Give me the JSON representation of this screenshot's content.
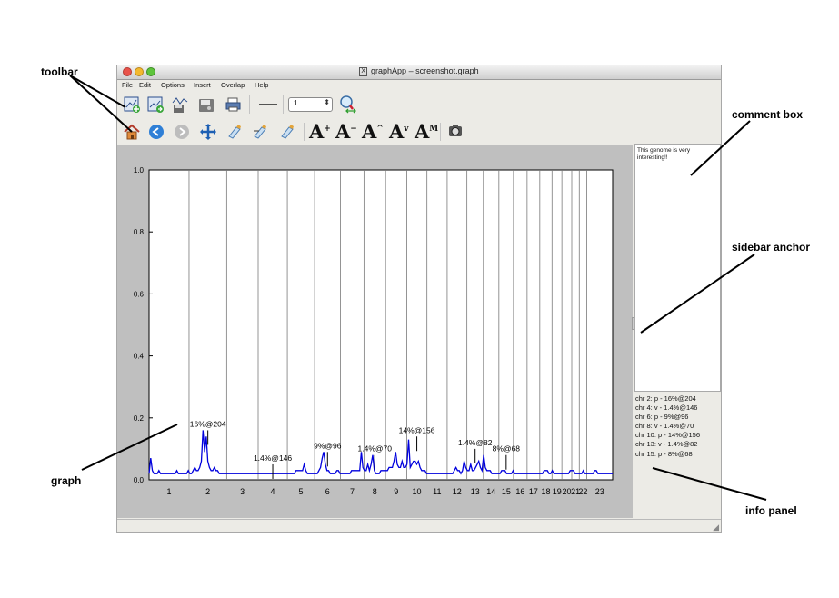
{
  "callouts": {
    "toolbar": "toolbar",
    "comment_box": "comment box",
    "sidebar_anchor": "sidebar anchor",
    "graph": "graph",
    "info_panel": "info panel"
  },
  "window": {
    "title": "graphApp – screenshot.graph",
    "title_icon": "X",
    "menu": [
      "File",
      "Edit",
      "Options",
      "Insert",
      "Overlap",
      "Help"
    ]
  },
  "toolbar": {
    "row1_icons": [
      "new-graph-icon",
      "open-graph-icon",
      "save-graph-icon",
      "save-as-icon",
      "print-icon",
      "line-style-icon",
      "zoom-icon"
    ],
    "line_width_value": "1",
    "row2_icons": [
      "home-icon",
      "back-icon",
      "forward-icon",
      "pan-icon",
      "zoom-in-icon",
      "zoom-out-icon",
      "zoom-reset-icon",
      "font-bigger-icon",
      "font-smaller-icon",
      "font-up-icon",
      "font-down-icon",
      "font-max-icon",
      "screenshot-icon"
    ]
  },
  "comment": {
    "text": "This genome is very interesting!!"
  },
  "info": {
    "lines": [
      "chr 2: p - 16%@204",
      "chr 4: v - 1.4%@146",
      "chr 6: p - 9%@96",
      "chr 8: v - 1.4%@70",
      "chr 10: p - 14%@156",
      "chr 13: v - 1.4%@82",
      "chr 15: p - 8%@68"
    ]
  },
  "chart_data": {
    "type": "line",
    "title": "",
    "xlabel": "",
    "ylabel": "",
    "ylim": [
      0,
      1.0
    ],
    "yticks": [
      "0.0",
      "0.2",
      "0.4",
      "0.6",
      "0.8",
      "1.0"
    ],
    "chromosomes": [
      "1",
      "2",
      "3",
      "4",
      "5",
      "6",
      "7",
      "8",
      "9",
      "10",
      "11",
      "12",
      "13",
      "14",
      "15",
      "16",
      "17",
      "18",
      "19",
      "20",
      "21",
      "22",
      "23"
    ],
    "line_color": "#0000dd",
    "series": [
      {
        "values": [
          0.02,
          0.07,
          0.03,
          0.02,
          0.02,
          0.02,
          0.03,
          0.02,
          0.02,
          0.02,
          0.02,
          0.02,
          0.02,
          0.02,
          0.02,
          0.02,
          0.02,
          0.03,
          0.02,
          0.02,
          0.02,
          0.02,
          0.02,
          0.02,
          0.03,
          0.02,
          0.02,
          0.03,
          0.04,
          0.03,
          0.03,
          0.04,
          0.06,
          0.16,
          0.09,
          0.14,
          0.06,
          0.04,
          0.03,
          0.03,
          0.04,
          0.03,
          0.03,
          0.02,
          0.02,
          0.02,
          0.02,
          0.02,
          0.02,
          0.02,
          0.02,
          0.02,
          0.02,
          0.02,
          0.02,
          0.02,
          0.02,
          0.02,
          0.02,
          0.02,
          0.02,
          0.02,
          0.02,
          0.02,
          0.02,
          0.02,
          0.02,
          0.02,
          0.02,
          0.02,
          0.02,
          0.02,
          0.02,
          0.02,
          0.02,
          0.02,
          0.02,
          0.02,
          0.02,
          0.02,
          0.02,
          0.02,
          0.02,
          0.02,
          0.02,
          0.02,
          0.02,
          0.02,
          0.02,
          0.02,
          0.03,
          0.03,
          0.03,
          0.03,
          0.03,
          0.05,
          0.03,
          0.02,
          0.02,
          0.02,
          0.02,
          0.02,
          0.02,
          0.02,
          0.03,
          0.04,
          0.07,
          0.09,
          0.05,
          0.03,
          0.03,
          0.02,
          0.02,
          0.02,
          0.02,
          0.03,
          0.03,
          0.02,
          0.02,
          0.02,
          0.02,
          0.02,
          0.02,
          0.02,
          0.03,
          0.03,
          0.03,
          0.03,
          0.03,
          0.03,
          0.09,
          0.04,
          0.03,
          0.03,
          0.05,
          0.03,
          0.05,
          0.08,
          0.03,
          0.02,
          0.02,
          0.02,
          0.03,
          0.03,
          0.03,
          0.03,
          0.03,
          0.04,
          0.04,
          0.04,
          0.06,
          0.09,
          0.05,
          0.04,
          0.04,
          0.06,
          0.04,
          0.04,
          0.05,
          0.13,
          0.04,
          0.05,
          0.06,
          0.06,
          0.05,
          0.06,
          0.04,
          0.03,
          0.03,
          0.03,
          0.02,
          0.02,
          0.02,
          0.02,
          0.02,
          0.02,
          0.02,
          0.02,
          0.02,
          0.02,
          0.02,
          0.02,
          0.02,
          0.02,
          0.02,
          0.02,
          0.02,
          0.03,
          0.04,
          0.03,
          0.03,
          0.02,
          0.03,
          0.06,
          0.04,
          0.03,
          0.03,
          0.05,
          0.03,
          0.03,
          0.04,
          0.05,
          0.06,
          0.04,
          0.03,
          0.08,
          0.04,
          0.03,
          0.03,
          0.03,
          0.02,
          0.02,
          0.02,
          0.02,
          0.02,
          0.02,
          0.03,
          0.03,
          0.03,
          0.02,
          0.02,
          0.02,
          0.02,
          0.03,
          0.02,
          0.02,
          0.02,
          0.02,
          0.02,
          0.02,
          0.02,
          0.02,
          0.02,
          0.02,
          0.02,
          0.02,
          0.02,
          0.02,
          0.02,
          0.02,
          0.02,
          0.02,
          0.03,
          0.03,
          0.03,
          0.02,
          0.02,
          0.03,
          0.02,
          0.02,
          0.02,
          0.02,
          0.02,
          0.02,
          0.02,
          0.02,
          0.02,
          0.02,
          0.03,
          0.03,
          0.03,
          0.02,
          0.02,
          0.02,
          0.02,
          0.02,
          0.03,
          0.02,
          0.02,
          0.02,
          0.02,
          0.02,
          0.02,
          0.03,
          0.03,
          0.02,
          0.02,
          0.02,
          0.02,
          0.02,
          0.02,
          0.02,
          0.02,
          0.02,
          0.02
        ]
      }
    ],
    "annotations": [
      {
        "label": "16%@204",
        "chr": "2",
        "y": 0.16
      },
      {
        "label": "1.4%@146",
        "chr": "4",
        "y": 0.05
      },
      {
        "label": "9%@96",
        "chr": "6",
        "y": 0.09
      },
      {
        "label": "1.4%@70",
        "chr": "8",
        "y": 0.08
      },
      {
        "label": "14%@156",
        "chr": "10",
        "y": 0.14
      },
      {
        "label": "1.4%@82",
        "chr": "13",
        "y": 0.1
      },
      {
        "label": "8%@68",
        "chr": "15",
        "y": 0.08
      }
    ],
    "grid": "vertical chromosome boundaries"
  }
}
